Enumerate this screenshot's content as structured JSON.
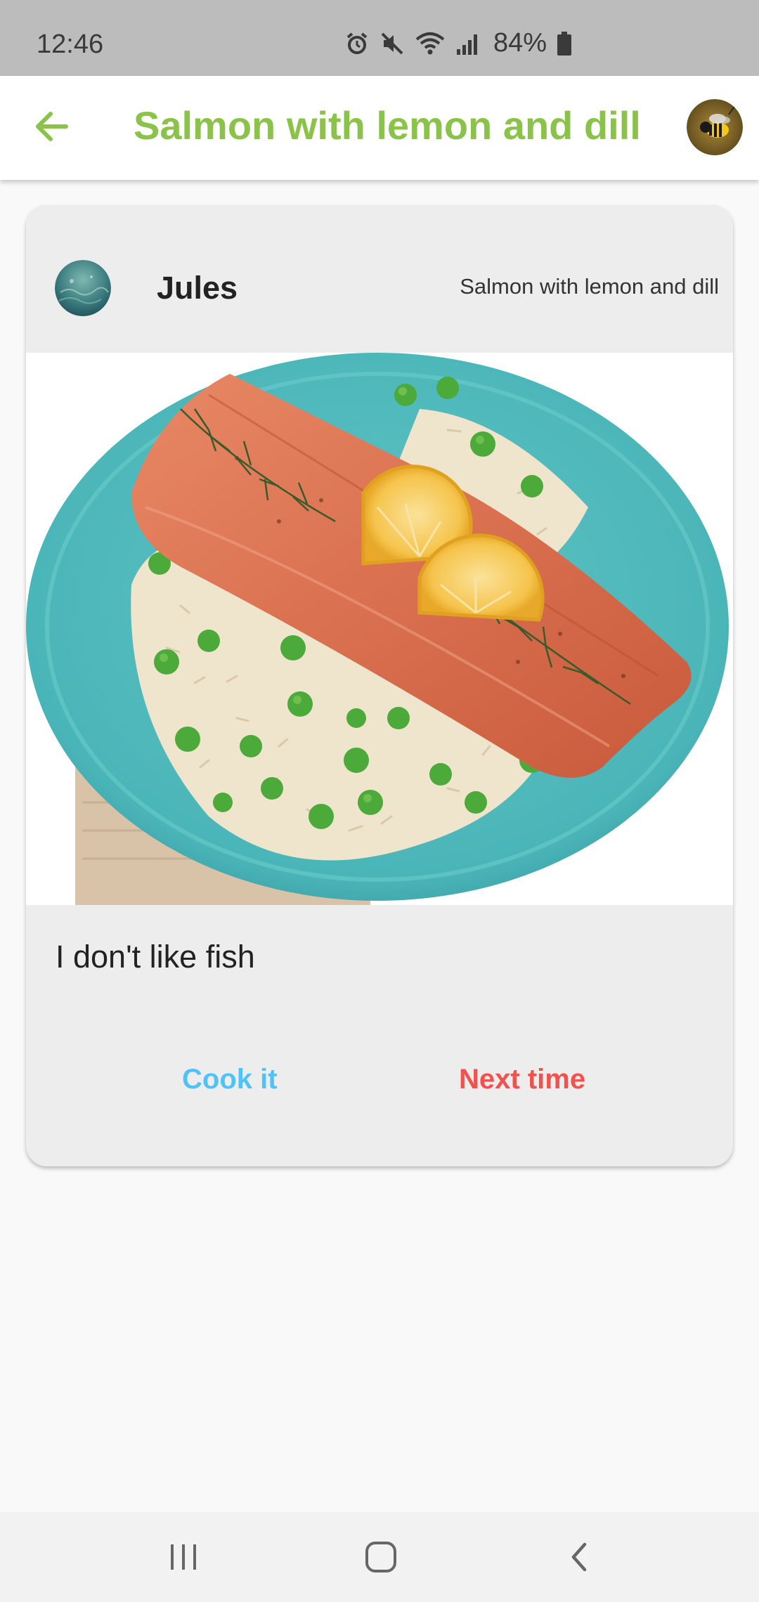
{
  "status_bar": {
    "time": "12:46",
    "battery": "84%",
    "icons": [
      "alarm-icon",
      "mute-icon",
      "wifi-icon",
      "signal-icon",
      "battery-icon"
    ]
  },
  "app_bar": {
    "title": "Salmon with lemon and dill",
    "back_icon": "arrow-left-icon",
    "title_color": "#8bc34a"
  },
  "post": {
    "author": "Jules",
    "recipe": "Salmon with lemon and dill",
    "comment": "I don't like fish",
    "actions": {
      "cook_label": "Cook it",
      "next_label": "Next time"
    }
  },
  "colors": {
    "accent_green": "#8bc34a",
    "cook_blue": "#4fc3f7",
    "next_red": "#ef5350"
  },
  "nav_bar": {
    "icons": [
      "recent-apps-icon",
      "home-icon",
      "back-icon"
    ]
  }
}
